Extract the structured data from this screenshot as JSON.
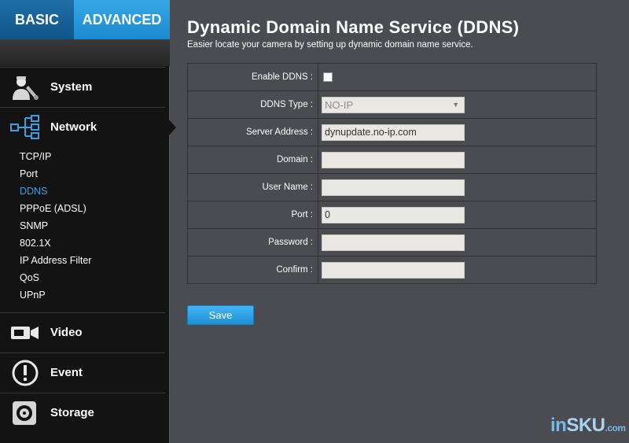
{
  "tabs": {
    "basic": "BASIC",
    "advanced": "ADVANCED"
  },
  "sidebar": {
    "sections": {
      "system": "System",
      "network": "Network",
      "video": "Video",
      "event": "Event",
      "storage": "Storage"
    },
    "network_items": [
      "TCP/IP",
      "Port",
      "DDNS",
      "PPPoE (ADSL)",
      "SNMP",
      "802.1X",
      "IP Address Filter",
      "QoS",
      "UPnP"
    ],
    "active_item": "DDNS"
  },
  "main": {
    "title": "Dynamic Domain Name Service (DDNS)",
    "subtitle": "Easier locate your camera by setting up dynamic domain name service."
  },
  "form": {
    "enable_label": "Enable DDNS :",
    "enable_checked": false,
    "type_label": "DDNS Type :",
    "type_value": "NO-IP",
    "server_label": "Server Address :",
    "server_value": "dynupdate.no-ip.com",
    "domain_label": "Domain :",
    "domain_value": "",
    "user_label": "User Name :",
    "user_value": "",
    "port_label": "Port :",
    "port_value": "0",
    "password_label": "Password :",
    "password_value": "",
    "confirm_label": "Confirm :",
    "confirm_value": "",
    "save_label": "Save"
  },
  "watermark": {
    "part1": "in",
    "part2": "SKU",
    "part3": ".com"
  },
  "colors": {
    "accent": "#1b8ad0",
    "active_link": "#3aa0e6",
    "panel": "#4a4c52",
    "sidebar": "#131313"
  }
}
